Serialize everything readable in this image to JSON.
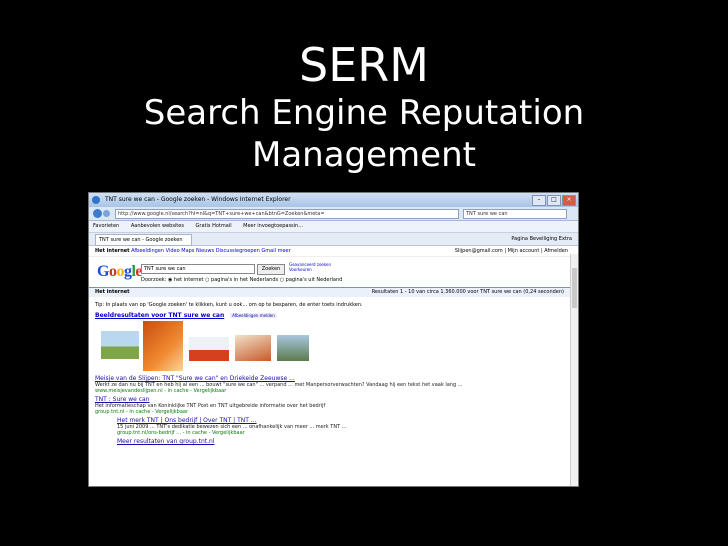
{
  "slide": {
    "title": "SERM",
    "subtitle_line1": "Search Engine Reputation",
    "subtitle_line2": "Management"
  },
  "browser": {
    "window_title": "TNT sure we can - Google zoeken - Windows Internet Explorer",
    "address": "http://www.google.nl/search?hl=nl&q=TNT+sure+we+can&btnG=Zoeken&meta=",
    "search_box": "TNT sure we can",
    "favorites": [
      "Favorieten",
      "Aanbevolen websites",
      "Gratis Hotmail",
      "Meer invoegtoepassin..."
    ],
    "tab_label": "TNT sure we can - Google zoeken",
    "toolbar_tools": "Pagina  Beveiliging  Extra"
  },
  "google": {
    "gbar_items": [
      "Het internet",
      "Afbeeldingen",
      "Video",
      "Maps",
      "Nieuws",
      "Discussiegroepen",
      "Gmail",
      "meer"
    ],
    "account": "Slijpen@gmail.com | Mijn account | Afmelden",
    "logo": "Google",
    "query": "TNT sure we can",
    "search_button": "Zoeken",
    "advanced": "Geavanceerd zoeken Voorkeuren",
    "radio_label": "Doorzoek:",
    "radios": [
      "het internet",
      "pagina's in het Nederlands",
      "pagina's uit Nederland"
    ],
    "results_label": "Het internet",
    "stats": "Resultaten 1 - 10 van circa 1.360.000 voor TNT sure we can (0,24 seconden)",
    "tip": "Tip: In plaats van op 'Google zoeken' te klikken, kunt u ook... om op te besparen, de enter toets indrukken.",
    "image_results_title": "Beeldresultaten voor TNT sure we can",
    "image_results_more": "Afbeeldingen melden",
    "results": [
      {
        "title": "Meisje van de Slijpen: TNT \"Sure we can\" en Driekeide Zeeuwse ...",
        "snippet": "Werkt ze dan nu bij TNT en heb hij al een ... bouwt \"sure we can\" ... verpand ... met Manpersorverwachten? Vandaag hij een tekst het vaak lang ...",
        "url": "www.meisjevandeslijpen.nl - in cache - Vergelijkbaar"
      },
      {
        "title": "TNT : Sure we can",
        "snippet": "Het informatieschap van Koninklijke TNT Post en TNT uitgebreide informatie over het bedrijf",
        "url": "group.tnt.nl - in cache - Vergelijkbaar"
      },
      {
        "title": "Het merk TNT | Ons bedrijf | Over TNT | TNT ...",
        "snippet": "15 juni 2009 ... TNT's dedikatie bewezen sich een ... onafhankelijk van meer ... merk TNT ...",
        "url": "group.tnt.nl/ons-bedrijf ... - in cache - Vergelijkbaar"
      },
      {
        "title": "Meer resultaten van group.tnt.nl",
        "snippet": "",
        "url": ""
      }
    ]
  },
  "colors": {
    "background": "#000000",
    "slide_text": "#ffffff",
    "link": "#1a0dab",
    "url_green": "#0a7a0a"
  }
}
